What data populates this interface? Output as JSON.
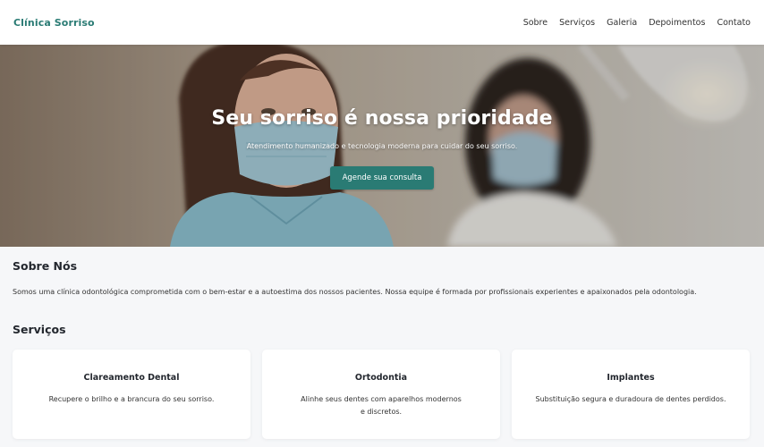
{
  "header": {
    "brand": "Clínica Sorriso",
    "nav": [
      "Sobre",
      "Serviços",
      "Galeria",
      "Depoimentos",
      "Contato"
    ]
  },
  "hero": {
    "title": "Seu sorriso é nossa prioridade",
    "subtitle": "Atendimento humanizado e tecnologia moderna para cuidar do seu sorriso.",
    "cta": "Agende sua consulta"
  },
  "about": {
    "title": "Sobre Nós",
    "text": "Somos uma clínica odontológica comprometida com o bem-estar e a autoestima dos nossos pacientes. Nossa equipe é formada por profissionais experientes e apaixonados pela odontologia."
  },
  "services": {
    "title": "Serviços",
    "items": [
      {
        "title": "Clareamento Dental",
        "text": "Recupere o brilho e a brancura do seu sorriso."
      },
      {
        "title": "Ortodontia",
        "text": "Alinhe seus dentes com aparelhos modernos e discretos."
      },
      {
        "title": "Implantes",
        "text": "Substituição segura e duradoura de dentes perdidos."
      }
    ]
  },
  "colors": {
    "brand": "#2a7b74",
    "background": "#f6f7f9",
    "card": "#ffffff"
  }
}
